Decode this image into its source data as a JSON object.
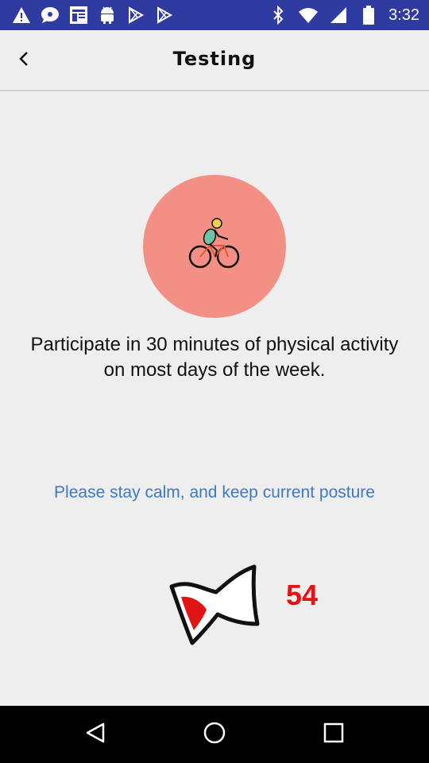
{
  "status_bar": {
    "time": "3:32",
    "left_icons": [
      "warning-icon",
      "chat-icon",
      "news-icon",
      "android-icon",
      "play-store-icon",
      "play-store-icon"
    ],
    "right_icons": [
      "bluetooth-icon",
      "wifi-icon",
      "signal-icon",
      "battery-icon"
    ],
    "background": "#2f3ba0"
  },
  "app_bar": {
    "title": "Testing",
    "back_icon": "chevron-left-icon"
  },
  "activity": {
    "icon": "cyclist-icon",
    "circle_color": "#f48f86"
  },
  "tip": {
    "text": "Participate in 30 minutes of physical activity on most days of the week."
  },
  "instruction": {
    "text": "Please stay calm, and keep current posture",
    "color": "#3f78c4"
  },
  "measurement": {
    "icon": "blood-pressure-cuff-icon",
    "value": "54",
    "color": "#e01414"
  },
  "nav_bar": {
    "buttons": [
      "back-triangle-icon",
      "home-circle-icon",
      "recents-square-icon"
    ]
  }
}
